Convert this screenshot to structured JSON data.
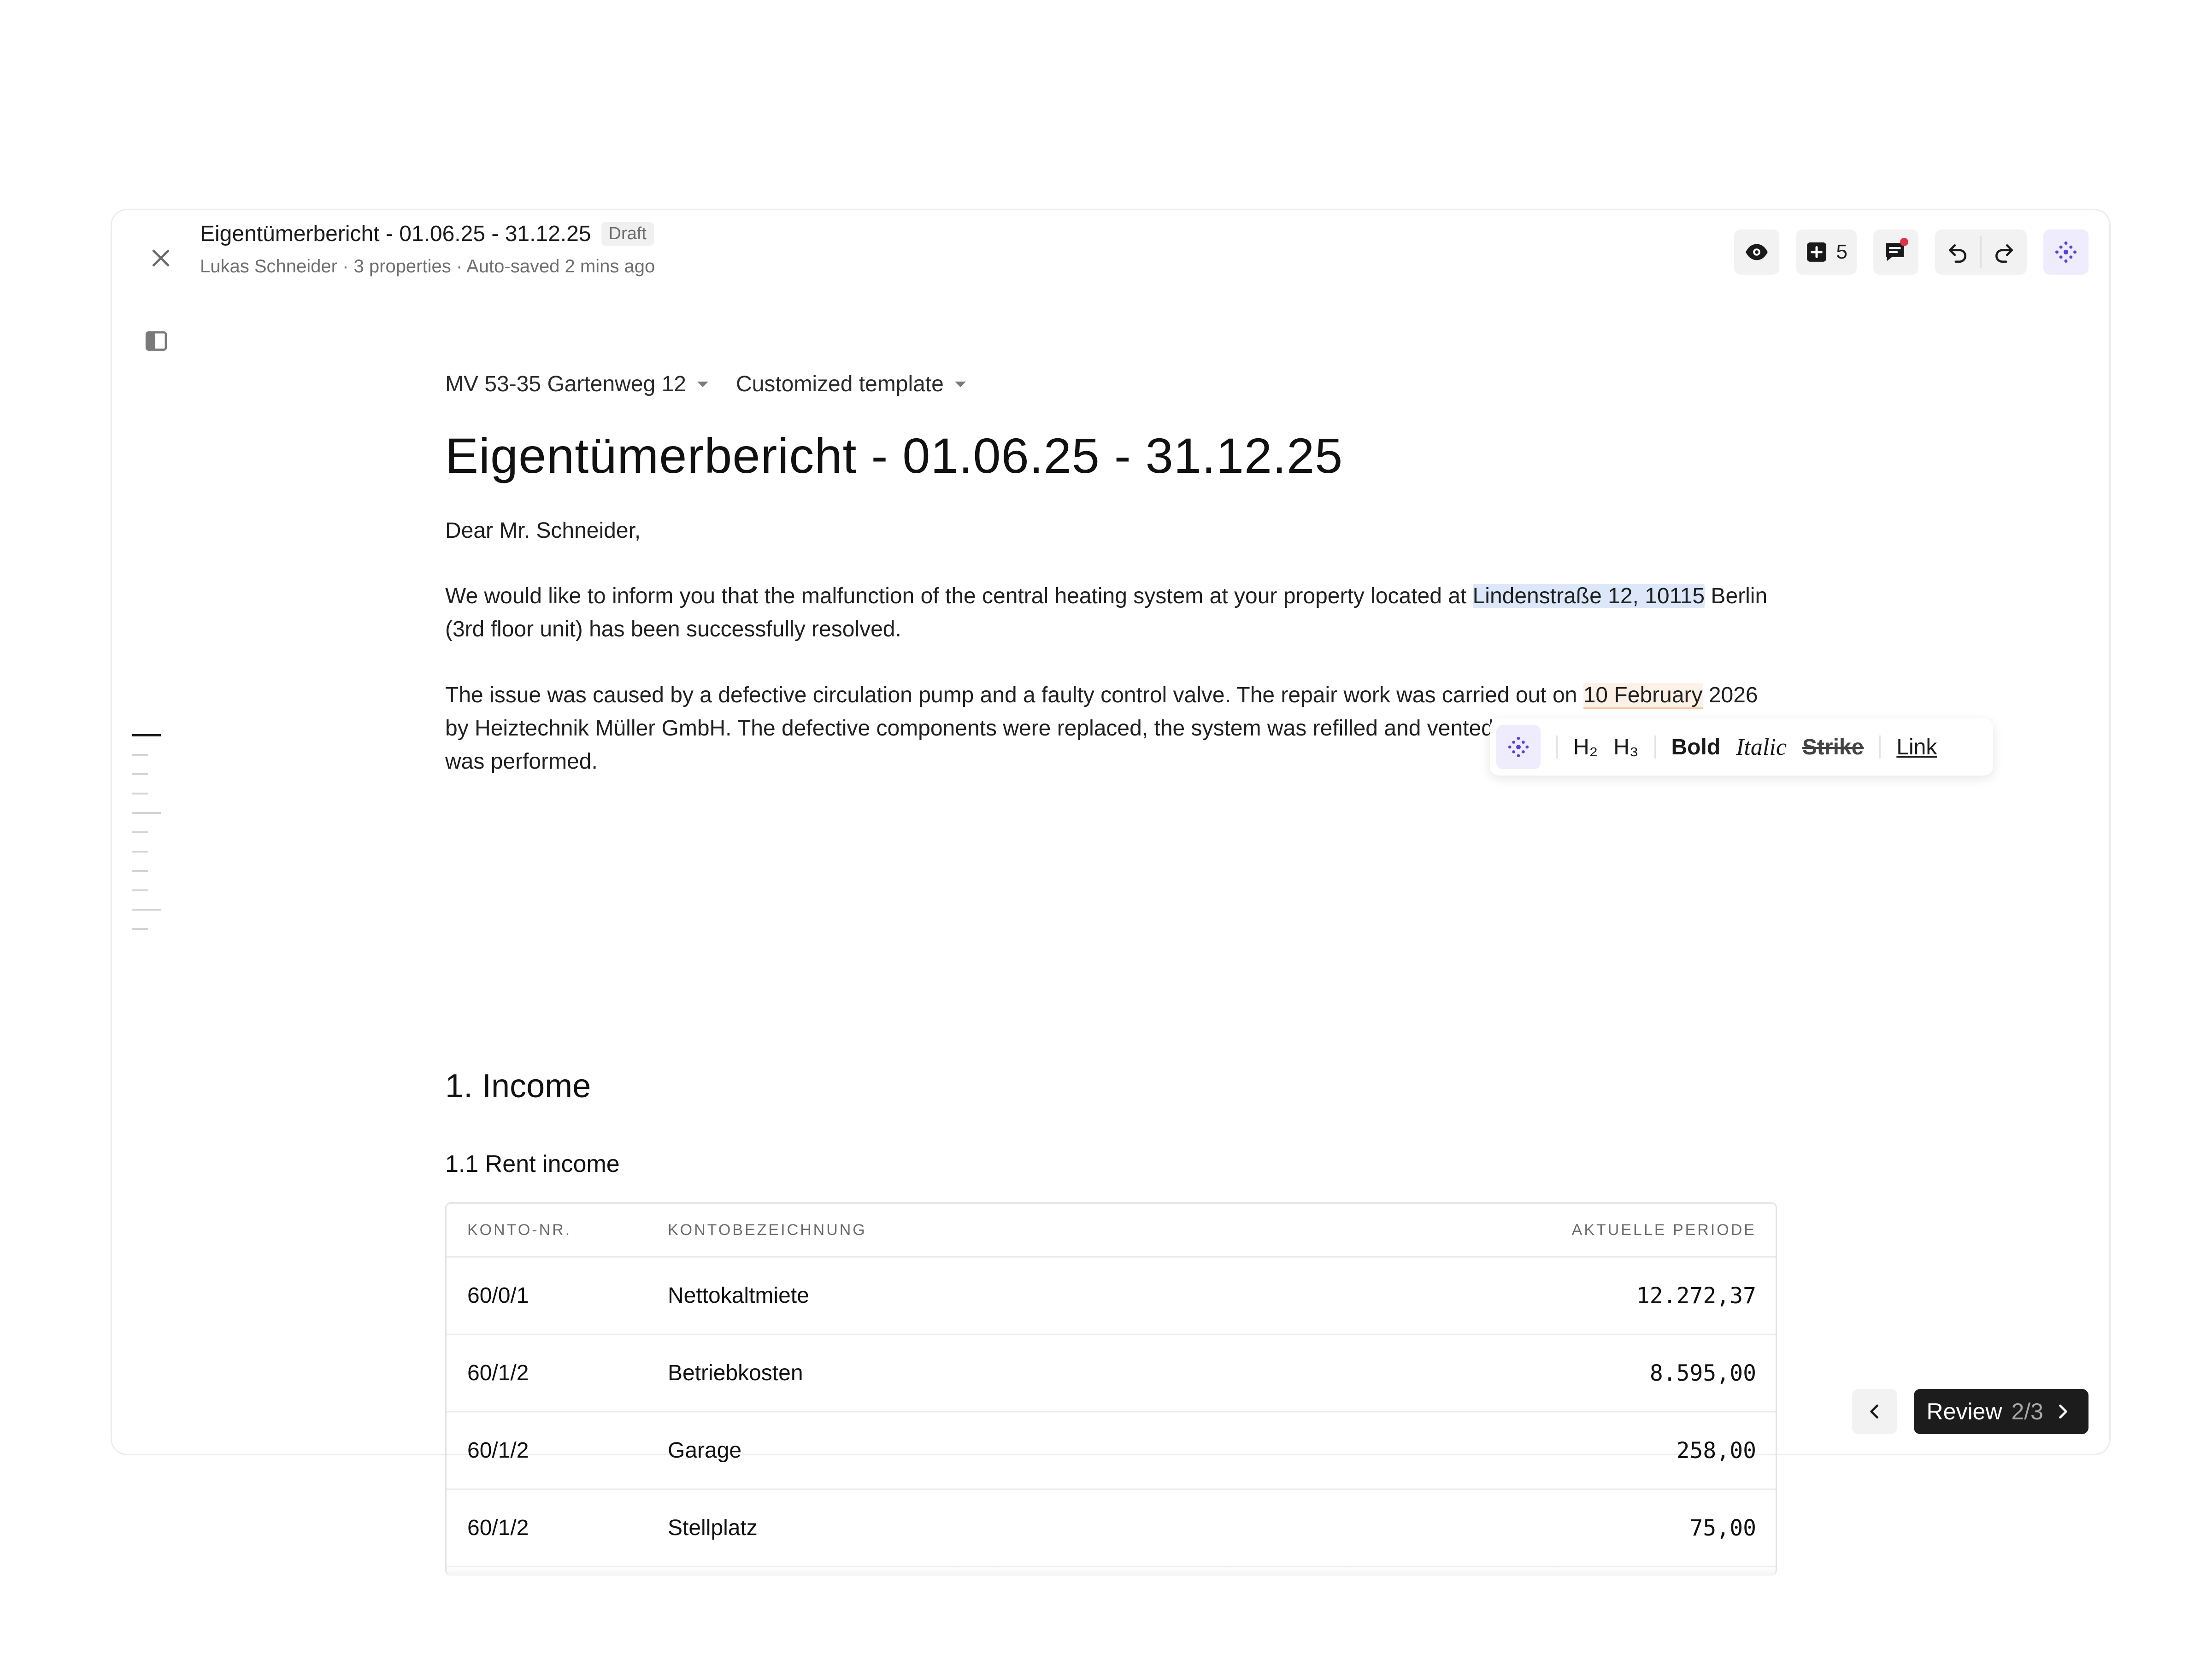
{
  "header": {
    "title": "Eigentümerbericht  - 01.06.25 - 31.12.25",
    "badge": "Draft",
    "meta": "Lukas Schneider · 3 properties · Auto-saved 2 mins ago"
  },
  "toolbar": {
    "preview_icon": "eye-icon",
    "add_count": "5",
    "comments_icon": "comment-icon",
    "undo_icon": "undo-icon",
    "redo_icon": "redo-icon",
    "ai_icon": "sparkle-icon"
  },
  "document": {
    "property_selector": "MV 53-35 Gartenweg 12",
    "template_selector": "Customized template",
    "title": "Eigentümerbericht  - 01.06.25 - 31.12.25",
    "greeting": "Dear Mr. Schneider,",
    "para1_before": "We would like to inform you that the malfunction of the central heating system at your property located at ",
    "para1_highlight": "Lindenstraße 12, 10115",
    "para1_after": " Berlin (3rd floor unit) has been successfully resolved.",
    "para2_before": "The issue was caused by a defective circulation pump and a faulty control valve. The repair work was carried out on ",
    "para2_highlight": "10 February",
    "para2_after": " 2026 by Heiztechnik Müller GmbH. The defective components were replaced, the system was refilled and vented, and a full functional test was performed.",
    "section_heading": "1. Income",
    "subsection_heading": "1.1 Rent income"
  },
  "format_bar": {
    "h2": "H₂",
    "h3": "H₃",
    "bold": "Bold",
    "italic": "Italic",
    "strike": "Strike",
    "link": "Link"
  },
  "table": {
    "headers": [
      "KONTO-NR.",
      "KONTOBEZEICHNUNG",
      "AKTUELLE PERIODE"
    ],
    "rows": [
      [
        "60/0/1",
        "Nettokaltmiete",
        "12.272,37"
      ],
      [
        "60/1/2",
        "Betriebkosten",
        "8.595,00"
      ],
      [
        "60/1/2",
        "Garage",
        "258,00"
      ],
      [
        "60/1/2",
        "Stellplatz",
        "75,00"
      ]
    ]
  },
  "review": {
    "label": "Review",
    "count": "2/3"
  },
  "colors": {
    "accent": "#5b3fd6",
    "highlight_blue": "#dce8fa",
    "highlight_orange": "#fdf1e7",
    "notification": "#e0334a"
  }
}
